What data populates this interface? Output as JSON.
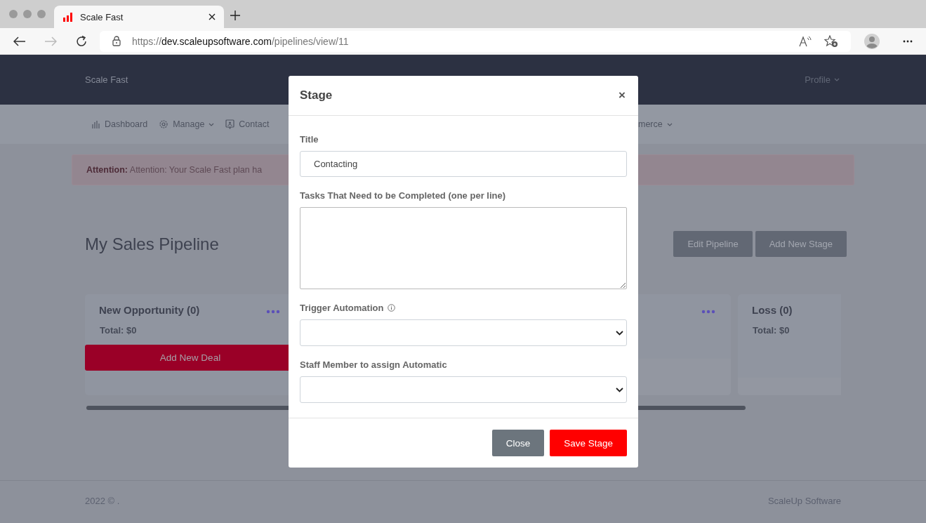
{
  "browser": {
    "tab_title": "Scale Fast",
    "url_prefix": "https://",
    "url_host": "dev.scaleupsoftware.com",
    "url_path": "/pipelines/view/11"
  },
  "header": {
    "brand": "Scale Fast",
    "profile": "Profile"
  },
  "nav": {
    "items": [
      {
        "label": "Dashboard",
        "dropdown": false
      },
      {
        "label": "Manage",
        "dropdown": true
      },
      {
        "label": "Contact",
        "dropdown": false
      }
    ],
    "right_item": {
      "label": "merce",
      "dropdown": true
    }
  },
  "alert": {
    "text": "**Attention:** Attention: Your Scale Fast plan ha"
  },
  "page": {
    "title": "My Sales Pipeline",
    "buttons": [
      "Edit Pipeline",
      "Add New Stage"
    ]
  },
  "stages": [
    {
      "title": "New Opportunity (0)",
      "total": "Total: $0",
      "button": "Add New Deal",
      "menu": true
    },
    {
      "menu": true
    },
    {
      "title": "Loss (0)",
      "total": "Total: $0"
    }
  ],
  "footer": {
    "left": "2022 © .",
    "right": "ScaleUp Software"
  },
  "modal": {
    "title": "Stage",
    "close_icon": "×",
    "fields": [
      {
        "kind": "text",
        "label": "Title",
        "value": "Contacting",
        "info": false
      },
      {
        "kind": "textarea",
        "label": "Tasks That Need to be Completed (one per line)",
        "info": false
      },
      {
        "kind": "select",
        "label": "Trigger Automation",
        "info": true
      },
      {
        "kind": "select",
        "label": "Staff Member to assign Automatic",
        "info": false
      }
    ],
    "buttons": [
      {
        "label": "Close",
        "kind": "secondary"
      },
      {
        "label": "Save Stage",
        "kind": "primary"
      }
    ]
  }
}
